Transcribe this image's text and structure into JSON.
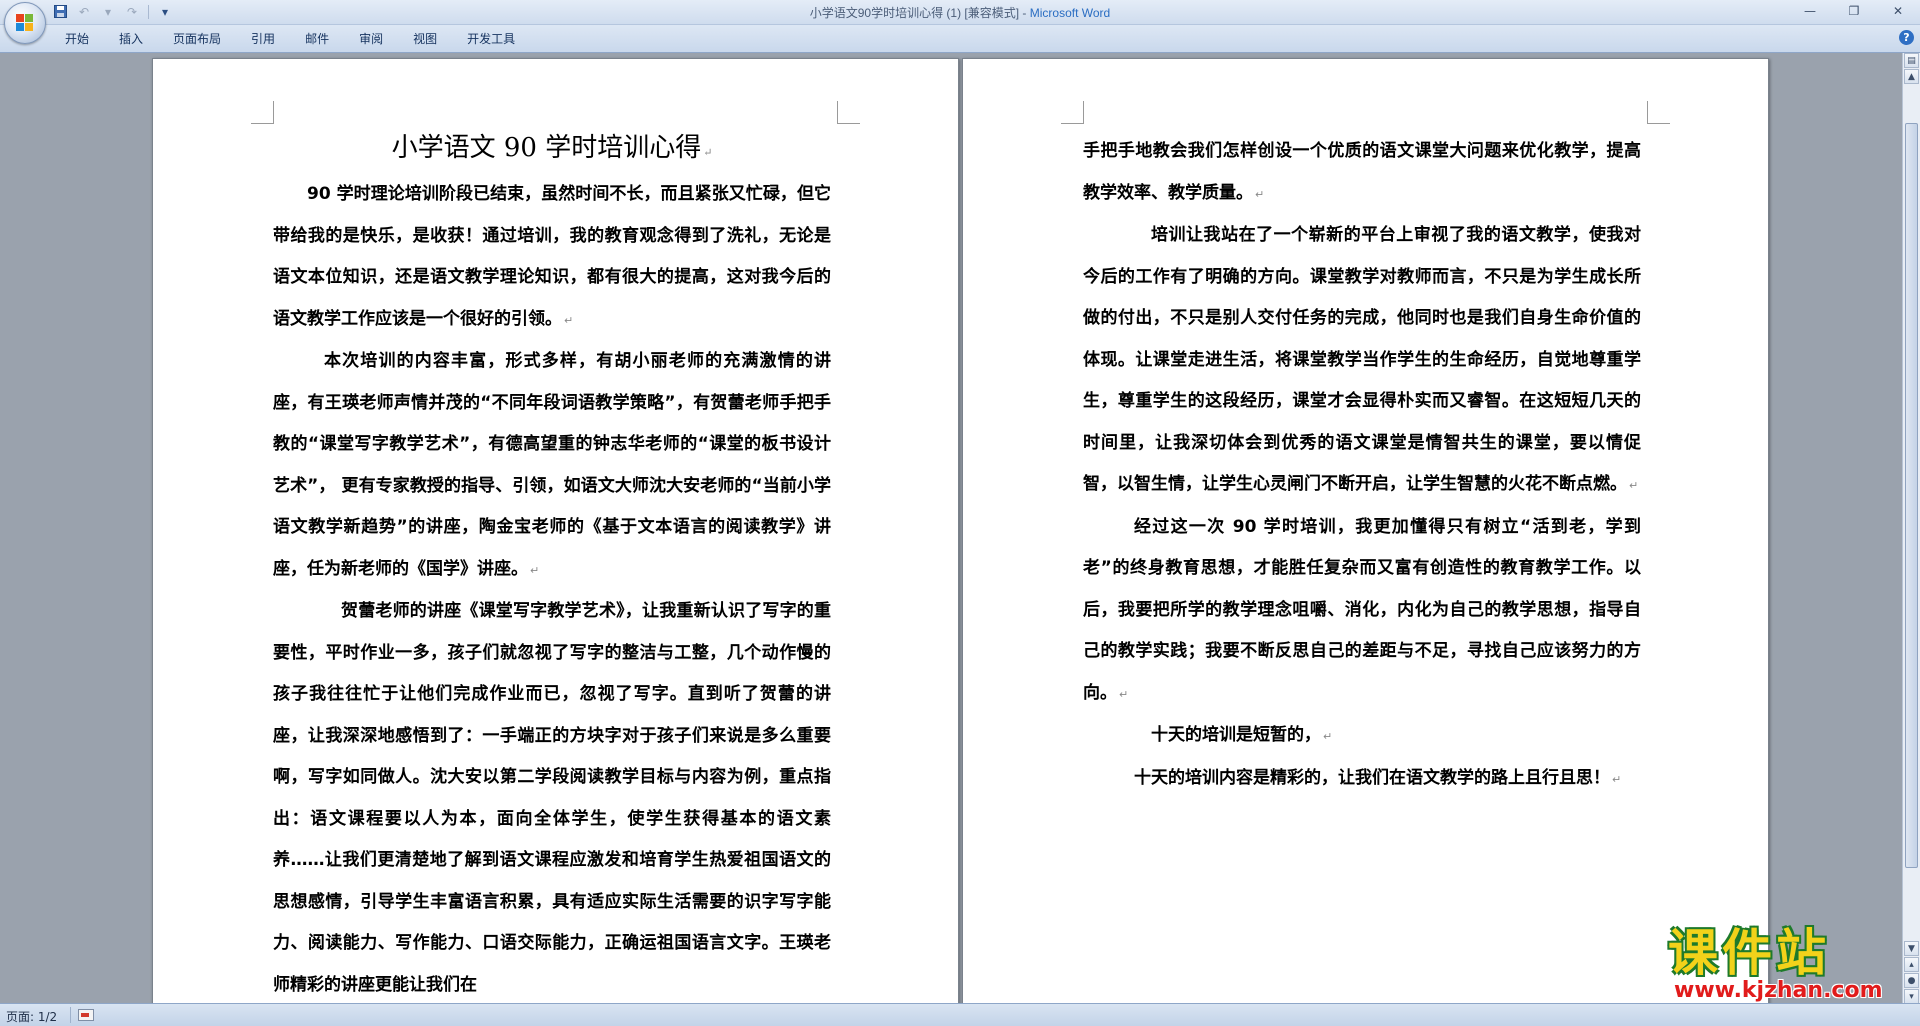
{
  "window": {
    "title": "小学语文90学时培训心得 (1) [兼容模式] - ",
    "app_name": "Microsoft Word",
    "controls": [
      "—",
      "❐",
      "✕"
    ]
  },
  "quick_access": {
    "save_icon": "save-icon",
    "undo_icon": "undo-icon",
    "redo_icon": "redo-icon",
    "customize_icon": "customize-qat-icon"
  },
  "ribbon": {
    "tabs": [
      "开始",
      "插入",
      "页面布局",
      "引用",
      "邮件",
      "审阅",
      "视图",
      "开发工具"
    ],
    "help": "?"
  },
  "document": {
    "title": "小学语文 90 学时培训心得",
    "page1_paragraphs": [
      "90 学时理论培训阶段已结束，虽然时间不长，而且紧张又忙碌，但它带给我的是快乐，是收获！通过培训，我的教育观念得到了洗礼，无论是语文本位知识，还是语文教学理论知识，都有很大的提高，这对我今后的语文教学工作应该是一个很好的引领。",
      "本次培训的内容丰富，形式多样，有胡小丽老师的充满激情的讲座，有王瑛老师声情并茂的“不同年段词语教学策略”，有贺蕾老师手把手教的“课堂写字教学艺术”，有德高望重的钟志华老师的“课堂的板书设计艺术”， 更有专家教授的指导、引领，如语文大师沈大安老师的“当前小学语文教学新趋势”的讲座，陶金宝老师的《基于文本语言的阅读教学》讲座，任为新老师的《国学》讲座。",
      "贺蕾老师的讲座《课堂写字教学艺术》，让我重新认识了写字的重要性，平时作业一多，孩子们就忽视了写字的整洁与工整，几个动作慢的孩子我往往忙于让他们完成作业而已，忽视了写字。直到听了贺蕾的讲座，让我深深地感悟到了：一手端正的方块字对于孩子们来说是多么重要啊，写字如同做人。沈大安以第二学段阅读教学目标与内容为例，重点指出：语文课程要以人为本，面向全体学生，使学生获得基本的语文素养……让我们更清楚地了解到语文课程应激发和培育学生热爱祖国语文的思想感情，引导学生丰富语言积累，具有适应实际生活需要的识字写字能力、阅读能力、写作能力、口语交际能力，正确运祖国语言文字。王瑛老师精彩的讲座更能让我们在"
    ],
    "page2_paragraphs": [
      "手把手地教会我们怎样创设一个优质的语文课堂大问题来优化教学，提高教学效率、教学质量。",
      "培训让我站在了一个崭新的平台上审视了我的语文教学，使我对今后的工作有了明确的方向。课堂教学对教师而言，不只是为学生成长所做的付出，不只是别人交付任务的完成，他同时也是我们自身生命价值的体现。让课堂走进生活，将课堂教学当作学生的生命经历，自觉地尊重学生，尊重学生的这段经历，课堂才会显得朴实而又睿智。在这短短几天的时间里，让我深切体会到优秀的语文课堂是情智共生的课堂，要以情促智，以智生情，让学生心灵闸门不断开启，让学生智慧的火花不断点燃。",
      "经过这一次 90 学时培训，我更加懂得只有树立“活到老，学到老”的终身教育思想，才能胜任复杂而又富有创造性的教育教学工作。以后，我要把所学的教学理念咀嚼、消化，内化为自己的教学思想，指导自己的教学实践；我要不断反思自己的差距与不足，寻找自己应该努力的方向。",
      "十天的培训是短暂的，",
      "十天的培训内容是精彩的，让我们在语文教学的路上且行且思！"
    ],
    "para_mark": "↵"
  },
  "status": {
    "page": "页面: 1/2"
  },
  "watermark": {
    "brand": "课件站",
    "url": "www.kjzhan.com"
  }
}
